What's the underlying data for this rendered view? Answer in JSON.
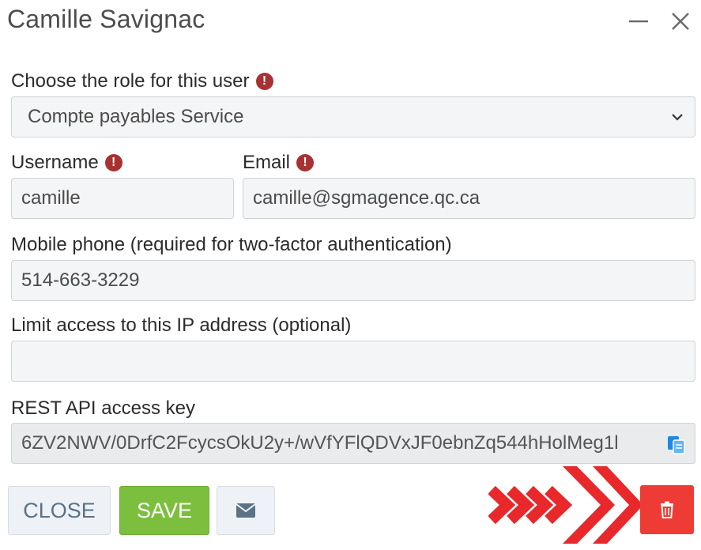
{
  "window": {
    "title": "Camille Savignac",
    "minimize_icon": "minimize-icon",
    "close_icon": "close-icon"
  },
  "role": {
    "label": "Choose the role for this user",
    "value": "Compte payables Service"
  },
  "username": {
    "label": "Username",
    "value": "camille"
  },
  "email": {
    "label": "Email",
    "value": "camille@sgmagence.qc.ca"
  },
  "mobile": {
    "label": "Mobile phone (required for two-factor authentication)",
    "value": "514-663-3229"
  },
  "ip": {
    "label": "Limit access to this IP address (optional)",
    "value": ""
  },
  "api_key": {
    "label": "REST API access key",
    "value": "6ZV2NWV/0DrfC2FcycsOkU2y+/wVfYFlQDVxJF0ebnZq544hHolMeg1l"
  },
  "buttons": {
    "close_label": "CLOSE",
    "save_label": "SAVE",
    "mail_icon": "envelope-icon",
    "delete_icon": "trash-icon"
  },
  "colors": {
    "save": "#7cbf3e",
    "delete": "#ee3b36",
    "required": "#a83232",
    "arrow": "#e8282a"
  }
}
